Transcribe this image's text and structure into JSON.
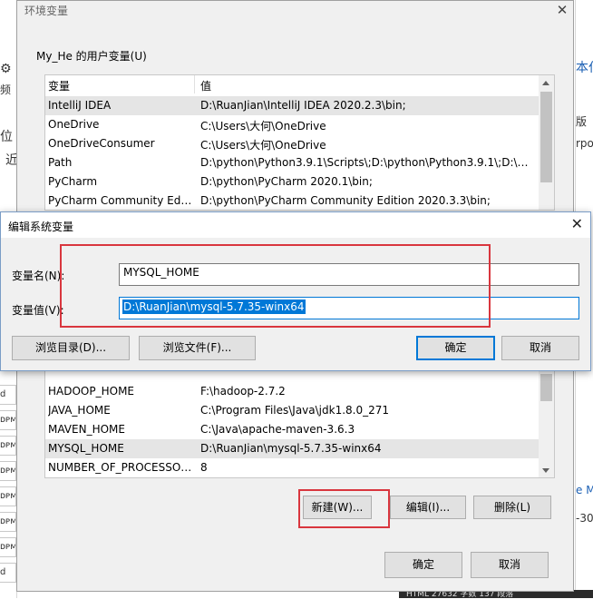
{
  "background": {
    "left_fragments": [
      "ɑ",
      "位",
      "近",
      "d",
      "d"
    ],
    "left_icon_label": "频",
    "left_cells": [
      "ᴅᴘᴍ",
      "ᴅᴘᴍ",
      "ᴅᴘᴍ",
      "ᴅᴘᴍ",
      "ᴅᴘᴍ",
      "ᴅᴘᴍ",
      "ᴅᴘᴍ",
      "ᴅᴘᴍ",
      "ᴅᴘᴍ"
    ],
    "right_fragments": [
      "本仆",
      "版",
      "rpo",
      "e M",
      "-30"
    ],
    "status_text": "HTML 27632 字数 137 段落"
  },
  "env_window": {
    "title": "环境变量",
    "close": "✕",
    "user_section_label": "My_He 的用户变量(U)",
    "user_header": {
      "name": "变量",
      "value": "值"
    },
    "user_rows": [
      {
        "name": "IntelliJ IDEA",
        "value": "D:\\RuanJian\\IntelliJ IDEA 2020.2.3\\bin;"
      },
      {
        "name": "OneDrive",
        "value": "C:\\Users\\大何\\OneDrive"
      },
      {
        "name": "OneDriveConsumer",
        "value": "C:\\Users\\大何\\OneDrive"
      },
      {
        "name": "Path",
        "value": "D:\\python\\Python3.9.1\\Scripts\\;D:\\python\\Python3.9.1\\;D:\\pyt..."
      },
      {
        "name": "PyCharm",
        "value": "D:\\python\\PyCharm 2020.1\\bin;"
      },
      {
        "name": "PyCharm Community Editi...",
        "value": "D:\\python\\PyCharm Community Edition 2020.3.3\\bin;"
      }
    ],
    "system_rows": [
      {
        "name": "HADOOP_HOME",
        "value": "F:\\hadoop-2.7.2"
      },
      {
        "name": "JAVA_HOME",
        "value": "C:\\Program Files\\Java\\jdk1.8.0_271"
      },
      {
        "name": "MAVEN_HOME",
        "value": "C:\\Java\\apache-maven-3.6.3"
      },
      {
        "name": "MYSQL_HOME",
        "value": "D:\\RuanJian\\mysql-5.7.35-winx64"
      },
      {
        "name": "NUMBER_OF_PROCESSORS",
        "value": "8"
      }
    ],
    "buttons": {
      "new": "新建(W)...",
      "edit": "编辑(I)...",
      "delete": "删除(L)",
      "ok": "确定",
      "cancel": "取消"
    }
  },
  "edit_dialog": {
    "title": "编辑系统变量",
    "close": "✕",
    "name_label": "变量名(N):",
    "name_value": "MYSQL_HOME",
    "value_label": "变量值(V):",
    "value_value": "D:\\RuanJian\\mysql-5.7.35-winx64",
    "buttons": {
      "browse_dir": "浏览目录(D)...",
      "browse_file": "浏览文件(F)...",
      "ok": "确定",
      "cancel": "取消"
    }
  },
  "colors": {
    "accent": "#0078d7",
    "highlight_box": "#d9363e",
    "selected_row": "#e5e5e5"
  }
}
